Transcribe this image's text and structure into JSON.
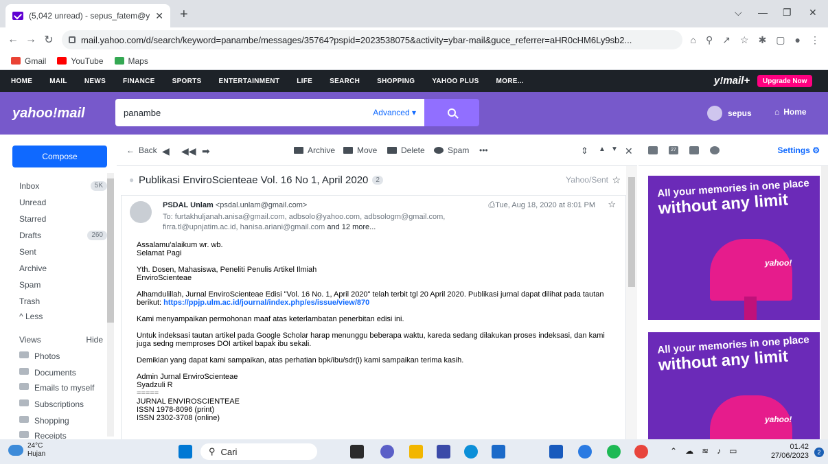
{
  "browser": {
    "tab_title": "(5,042 unread) - sepus_fatem@y",
    "url": "mail.yahoo.com/d/search/keyword=panambe/messages/35764?pspid=2023538075&activity=ybar-mail&guce_referrer=aHR0cHM6Ly9sb2...",
    "bookmarks": [
      "Gmail",
      "YouTube",
      "Maps"
    ]
  },
  "ynav": {
    "items": [
      "HOME",
      "MAIL",
      "NEWS",
      "FINANCE",
      "SPORTS",
      "ENTERTAINMENT",
      "LIFE",
      "SEARCH",
      "SHOPPING",
      "YAHOO PLUS",
      "MORE..."
    ],
    "logo": "y!mail+",
    "upgrade": "Upgrade Now"
  },
  "header": {
    "logo": "yahoo!mail",
    "search_value": "panambe",
    "advanced": "Advanced",
    "account_name": "sepus",
    "home": "Home"
  },
  "sidebar": {
    "compose": "Compose",
    "folders": [
      {
        "label": "Inbox",
        "badge": "5K"
      },
      {
        "label": "Unread",
        "badge": ""
      },
      {
        "label": "Starred",
        "badge": ""
      },
      {
        "label": "Drafts",
        "badge": "260"
      },
      {
        "label": "Sent",
        "badge": ""
      },
      {
        "label": "Archive",
        "badge": ""
      },
      {
        "label": "Spam",
        "badge": ""
      },
      {
        "label": "Trash",
        "badge": ""
      },
      {
        "label": "^ Less",
        "badge": ""
      }
    ],
    "views_label": "Views",
    "hide_label": "Hide",
    "views": [
      "Photos",
      "Documents",
      "Emails to myself",
      "Subscriptions",
      "Shopping",
      "Receipts"
    ]
  },
  "toolbar": {
    "back": "Back",
    "archive": "Archive",
    "move": "Move",
    "delete": "Delete",
    "spam": "Spam",
    "more": "•••"
  },
  "message": {
    "subject": "Publikasi EnviroScienteae Vol. 16 No 1, April 2020",
    "thread_count": "2",
    "folder_tag": "Yahoo/Sent",
    "sender_name": "PSDAL Unlam",
    "sender_email": "<psdal.unlam@gmail.com>",
    "recipients_line1": "To: furtakhuljanah.anisa@gmail.com, adbsolo@yahoo.com, adbsologm@gmail.com,",
    "recipients_line2": "firra.tl@upnjatim.ac.id, hanisa.ariani@gmail.com",
    "more_recipients": "and 12 more...",
    "date": "Tue, Aug 18, 2020 at 8:01 PM",
    "body": {
      "p1a": "Assalamu'alaikum wr. wb.",
      "p1b": "Selamat Pagi",
      "p2a": "Yth. Dosen, Mahasiswa, Peneliti Penulis Artikel Ilmiah",
      "p2b": "EnviroScienteae",
      "p3": "Alhamdulillah, Jurnal EnviroScienteae Edisi \"Vol. 16 No. 1, April 2020\" telah terbit tgl 20 April 2020. Publikasi jurnal dapat dilihat pada tautan berikut:",
      "p3_link": "https://ppjp.ulm.ac.id/journal/index.php/es/issue/view/870",
      "p4": "Kami menyampaikan permohonan maaf atas keterlambatan penerbitan edisi ini.",
      "p5": "Untuk indeksasi tautan artikel pada Google Scholar harap menunggu beberapa waktu, kareda sedang dilakukan proses indeksasi, dan kami juga sedng memproses DOI artikel bapak ibu sekali.",
      "p6": "Demikian yang dapat kami sampaikan, atas perhatian bpk/ibu/sdr(i) kami sampaikan terima kasih.",
      "sig1": "Admin Jurnal EnviroScienteae",
      "sig2": "Syadzuli R",
      "sig3": "=====",
      "sig4": "JURNAL ENVIROSCIENTEAE",
      "sig5": "ISSN 1978-8096 (print)",
      "sig6": "ISSN 2302-3708 (online)"
    }
  },
  "rail": {
    "settings": "Settings",
    "calendar_day": "27",
    "ad_line1": "All your memories in one place",
    "ad_line2": "without any limit",
    "ad_brand": "yahoo!"
  },
  "taskbar": {
    "temp": "24°C",
    "weather": "Hujan",
    "search": "Cari",
    "time": "01.42",
    "date": "27/06/2023",
    "notifications": "2"
  },
  "colors": {
    "yahoo_purple": "#7759cb",
    "compose_blue": "#0f69ff",
    "upgrade_pink": "#ff0080",
    "nav_dark": "#1d2228"
  }
}
